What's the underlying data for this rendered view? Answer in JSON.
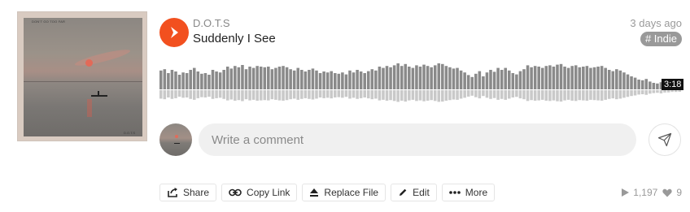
{
  "artwork": {
    "title_text": "DON'T GO TOO FAR",
    "footer_text": "D.O.T.S"
  },
  "track": {
    "artist": "D.O.T.S",
    "title": "Suddenly I See",
    "posted": "3 days ago",
    "tag": "# Indie",
    "duration": "3:18",
    "play_color": "#f2501f"
  },
  "waveform": {
    "color_top": "#8a8a8a",
    "color_bottom": "#c9c9c9",
    "levels": [
      0.58,
      0.62,
      0.5,
      0.6,
      0.55,
      0.45,
      0.52,
      0.5,
      0.6,
      0.66,
      0.55,
      0.48,
      0.5,
      0.45,
      0.6,
      0.55,
      0.52,
      0.6,
      0.7,
      0.64,
      0.72,
      0.68,
      0.75,
      0.62,
      0.7,
      0.66,
      0.72,
      0.7,
      0.68,
      0.7,
      0.62,
      0.66,
      0.7,
      0.72,
      0.68,
      0.62,
      0.58,
      0.66,
      0.6,
      0.55,
      0.6,
      0.64,
      0.58,
      0.5,
      0.55,
      0.52,
      0.56,
      0.5,
      0.48,
      0.52,
      0.46,
      0.58,
      0.52,
      0.6,
      0.55,
      0.5,
      0.56,
      0.62,
      0.58,
      0.7,
      0.66,
      0.72,
      0.68,
      0.74,
      0.8,
      0.72,
      0.78,
      0.7,
      0.66,
      0.74,
      0.7,
      0.76,
      0.72,
      0.68,
      0.74,
      0.8,
      0.78,
      0.72,
      0.68,
      0.64,
      0.66,
      0.58,
      0.52,
      0.44,
      0.38,
      0.48,
      0.56,
      0.4,
      0.52,
      0.6,
      0.54,
      0.66,
      0.6,
      0.66,
      0.58,
      0.5,
      0.46,
      0.56,
      0.62,
      0.74,
      0.68,
      0.72,
      0.7,
      0.66,
      0.72,
      0.74,
      0.7,
      0.76,
      0.78,
      0.7,
      0.66,
      0.72,
      0.74,
      0.68,
      0.7,
      0.72,
      0.66,
      0.68,
      0.7,
      0.72,
      0.66,
      0.6,
      0.56,
      0.62,
      0.58,
      0.52,
      0.46,
      0.4,
      0.36,
      0.3,
      0.28,
      0.32,
      0.24,
      0.2,
      0.18,
      0.22,
      0.16,
      0.15,
      0.12,
      0.12,
      0.1
    ]
  },
  "comment": {
    "placeholder": "Write a comment"
  },
  "actions": {
    "share": "Share",
    "copy_link": "Copy Link",
    "replace_file": "Replace File",
    "edit": "Edit",
    "more": "More"
  },
  "stats": {
    "plays": "1,197",
    "likes": "9"
  }
}
